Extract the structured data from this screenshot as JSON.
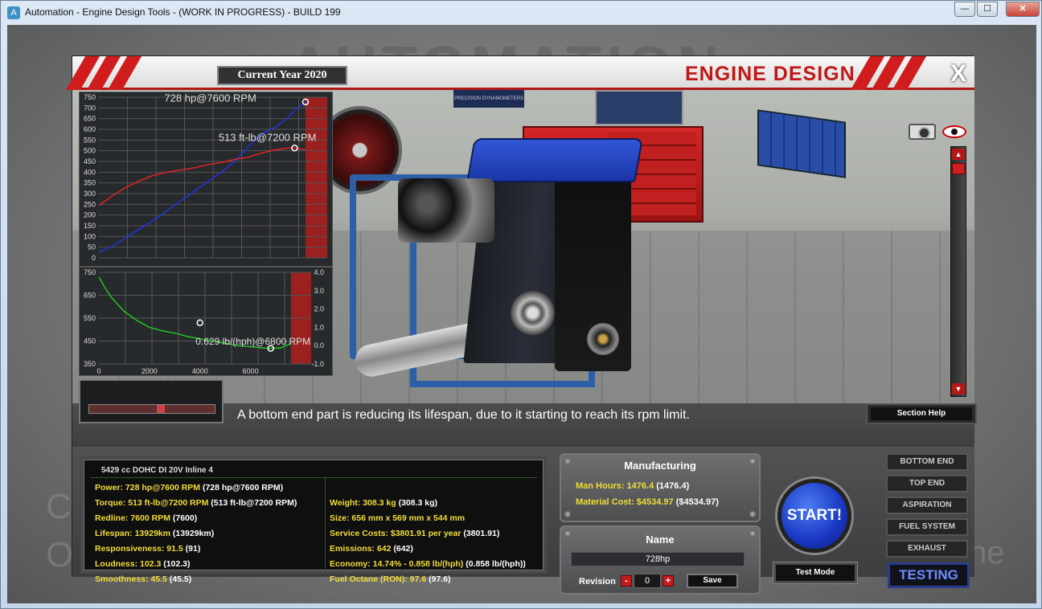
{
  "window": {
    "title": "Automation - Engine Design Tools - (WORK IN PROGRESS) - BUILD 199",
    "minimize": "—",
    "maximize": "☐",
    "close": "✕"
  },
  "background": {
    "logo_text": "AUTOMATION",
    "left_text_1": "C",
    "left_text_2": "O",
    "right_text": "ne"
  },
  "header": {
    "year_label": "Current Year 2020",
    "title": "ENGINE DESIGN",
    "close_label": "X"
  },
  "scene": {
    "poster_text": "PRECISION DYNAMOMETERS"
  },
  "chart_data": [
    {
      "type": "line",
      "x": [
        0,
        500,
        1000,
        1500,
        2000,
        2500,
        3000,
        3500,
        4000,
        4500,
        5000,
        5500,
        6000,
        6500,
        7000,
        7200,
        7600
      ],
      "ylim": [
        0,
        750
      ],
      "yticks": [
        0,
        50,
        100,
        150,
        200,
        250,
        300,
        350,
        400,
        450,
        500,
        550,
        600,
        650,
        700,
        750
      ],
      "xlim": [
        0,
        8400
      ],
      "series": [
        {
          "key": "power",
          "color": "#2233ee",
          "values": [
            25,
            55,
            95,
            135,
            175,
            220,
            265,
            310,
            355,
            400,
            450,
            520,
            580,
            610,
            660,
            690,
            728
          ]
        },
        {
          "key": "torque",
          "color": "#ee2222",
          "values": [
            245,
            290,
            330,
            360,
            385,
            400,
            410,
            420,
            435,
            445,
            460,
            470,
            490,
            505,
            513,
            513,
            505
          ]
        }
      ],
      "annotations": [
        "728 hp@7600 RPM",
        "513 ft-lb@7200 RPM"
      ],
      "redline_from": 7600
    },
    {
      "type": "line",
      "x": [
        0,
        200,
        500,
        1000,
        1500,
        2000,
        2500,
        3000,
        3500,
        4000,
        4500,
        5000,
        5500,
        6000,
        6500,
        6800,
        7200,
        7600
      ],
      "ylim": [
        350,
        750
      ],
      "yticks_left": [
        350,
        450,
        550,
        650,
        750
      ],
      "yticks_right": [
        "-1.0",
        "0.0",
        "1.0",
        "2.0",
        "3.0",
        "4.0"
      ],
      "xticks": [
        0,
        2000,
        4000,
        6000
      ],
      "xlim": [
        0,
        8400
      ],
      "series": [
        {
          "key": "economy",
          "color": "#22cc22",
          "values": [
            730,
            690,
            640,
            580,
            540,
            510,
            495,
            485,
            470,
            460,
            450,
            440,
            430,
            425,
            420,
            418,
            420,
            440
          ]
        }
      ],
      "annotations": [
        "0.629 lb/(hph)@6800 RPM"
      ],
      "redline_from": 7600
    }
  ],
  "message": "A bottom end part is reducing its lifespan, due to it starting to reach its rpm limit.",
  "section_help": "Section Help",
  "stats": {
    "engine": "5429 cc DOHC DI 20V Inline 4",
    "left": [
      {
        "label": "Power: 728 hp@7600 RPM",
        "val": "(728 hp@7600 RPM)"
      },
      {
        "label": "Torque: 513 ft-lb@7200 RPM",
        "val": "(513 ft-lb@7200 RPM)"
      },
      {
        "label": "Redline: 7600 RPM",
        "val": "(7600)"
      },
      {
        "label": "Lifespan: 13929km",
        "val": "(13929km)"
      },
      {
        "label": "Responsiveness: 91.5",
        "val": "(91)"
      },
      {
        "label": "Loudness: 102.3",
        "val": "(102.3)"
      },
      {
        "label": "Smoothness: 45.5",
        "val": "(45.5)"
      }
    ],
    "right": [
      {
        "label": "Weight: 308.3 kg",
        "val": "(308.3 kg)"
      },
      {
        "label": "Size: 656 mm x 569 mm x 544 mm",
        "val": ""
      },
      {
        "label": "Service Costs: $3801.91 per year",
        "val": "(3801.91)"
      },
      {
        "label": "Emissions: 642",
        "val": "(642)"
      },
      {
        "label": "Economy: 14.74% - 0.858 lb/(hph)",
        "val": "(0.858 lb/(hph))"
      },
      {
        "label": "Fuel Octane (RON): 97.6",
        "val": "(97.6)"
      }
    ]
  },
  "manufacturing": {
    "title": "Manufacturing",
    "hours_label": "Man Hours: 1476.4",
    "hours_val": "(1476.4)",
    "cost_label": "Material Cost: $4534.97",
    "cost_val": "($4534.97)"
  },
  "name_panel": {
    "title": "Name",
    "value": "728hp",
    "revision_label": "Revision",
    "revision": "0",
    "minus": "-",
    "plus": "+",
    "save": "Save"
  },
  "start": "START!",
  "test_mode": "Test Mode",
  "sections": [
    "BOTTOM END",
    "TOP END",
    "ASPIRATION",
    "FUEL SYSTEM",
    "EXHAUST"
  ],
  "testing": "TESTING",
  "colors": {
    "accent_red": "#c01818",
    "stat_yellow": "#f3dd3a",
    "start_blue": "#1936c2"
  }
}
